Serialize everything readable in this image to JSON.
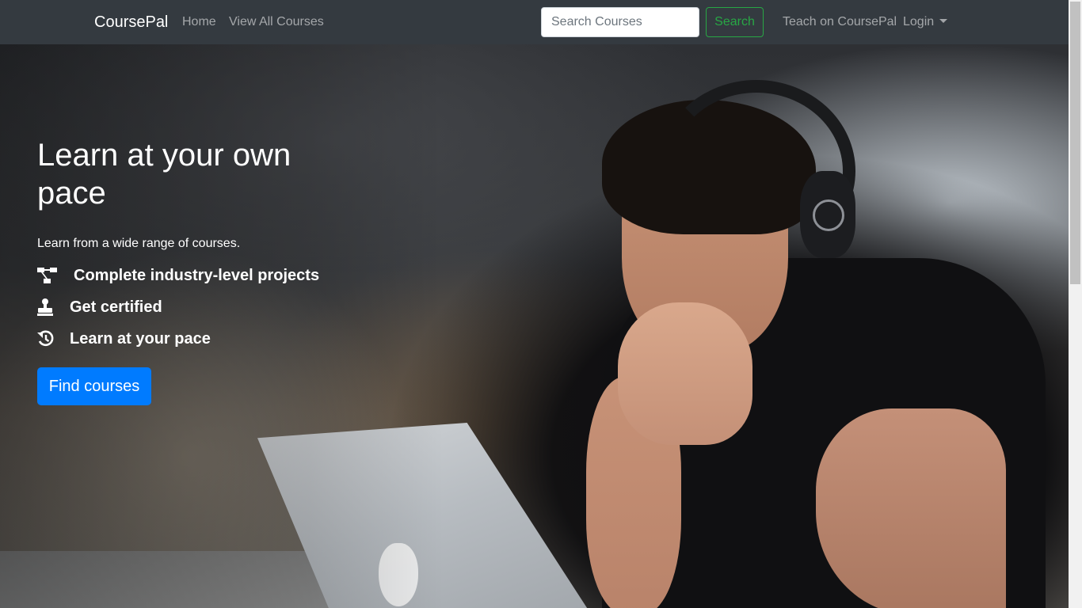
{
  "navbar": {
    "brand": "CoursePal",
    "links": {
      "home": "Home",
      "all_courses": "View All Courses",
      "teach": "Teach on CoursePal",
      "login": "Login"
    },
    "search": {
      "placeholder": "Search Courses",
      "value": "",
      "button_label": "Search"
    },
    "colors": {
      "background": "#343a40",
      "search_button": "#28a745"
    }
  },
  "hero": {
    "title": "Learn at your own pace",
    "subtitle": "Learn from a wide range of courses.",
    "features": [
      {
        "icon": "project-diagram-icon",
        "label": "Complete industry-level projects"
      },
      {
        "icon": "stamp-icon",
        "label": "Get certified"
      },
      {
        "icon": "history-icon",
        "label": "Learn at your pace"
      }
    ],
    "cta_label": "Find courses",
    "cta_color": "#007bff",
    "background_image": "man-with-headphones-at-laptop-photo"
  }
}
